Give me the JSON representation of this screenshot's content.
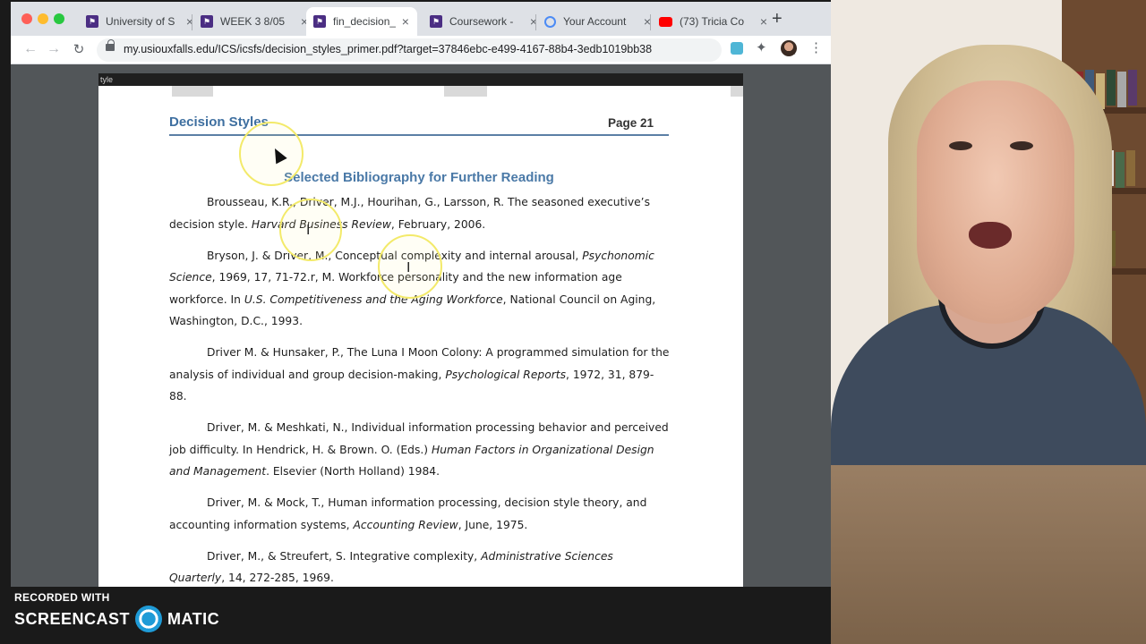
{
  "browser": {
    "tabs": [
      {
        "label": "University of S",
        "icon": "university-favicon"
      },
      {
        "label": "WEEK 3 8/05",
        "icon": "university-favicon"
      },
      {
        "label": "fin_decision_s",
        "icon": "university-favicon",
        "active": true
      },
      {
        "label": "Coursework -",
        "icon": "university-favicon"
      },
      {
        "label": "Your Account",
        "icon": "account-favicon"
      },
      {
        "label": "(73) Tricia Co",
        "icon": "youtube-favicon"
      }
    ],
    "new_tab_symbol": "+",
    "url": "my.usiouxfalls.edu/ICS/icsfs/decision_styles_primer.pdf?target=37846ebc-e499-4167-88b4-3edb1019bb38"
  },
  "pdf": {
    "previous_page_text": "tyle",
    "header_title": "Decision Styles",
    "page_label": "Page 21",
    "section_title": "Selected Bibliography for Further Reading",
    "entries": [
      {
        "a": "Brousseau, K.R., Driver, M.J., Hourihan, G., Larsson, R. The seasoned executive’s decision style. ",
        "i": "Harvard Business Review",
        "b": ", February, 2006."
      },
      {
        "a": "Bryson, J. & Driver, M., Conceptual complexity and internal arousal, ",
        "i": "Psychonomic Science",
        "b": ", 1969, 17, 71-72.r, M. Workforce personality and the new information age workforce. In ",
        "i2": "U.S. Competitiveness and the Aging Workforce",
        "c": ", National Council on Aging, Washington, D.C., 1993."
      },
      {
        "a": "Driver M. & Hunsaker, P., The Luna I Moon Colony: A programmed simulation for the analysis of individual and group decision-making, ",
        "i": "Psychological Reports",
        "b": ", 1972, 31, 879-88."
      },
      {
        "a": "Driver, M. & Meshkati, N., Individual information processing behavior and perceived job difficulty. In Hendrick, H. & Brown. O. (Eds.) ",
        "i": "Human Factors in Organizational Design and Management",
        "b": ". Elsevier (North Holland) 1984."
      },
      {
        "a": "Driver, M. & Mock, T., Human information processing, decision style theory, and accounting information systems, ",
        "i": "Accounting Review",
        "b": ", June, 1975."
      },
      {
        "a": "Driver, M., & Streufert, S. Integrative complexity, ",
        "i": "Administrative Sciences Quarterly",
        "b": ", 14, 272-285, 1969."
      }
    ]
  },
  "watermark": {
    "recorded_with": "RECORDED WITH",
    "brand_left": "SCREENCAST",
    "brand_right": "MATIC"
  }
}
